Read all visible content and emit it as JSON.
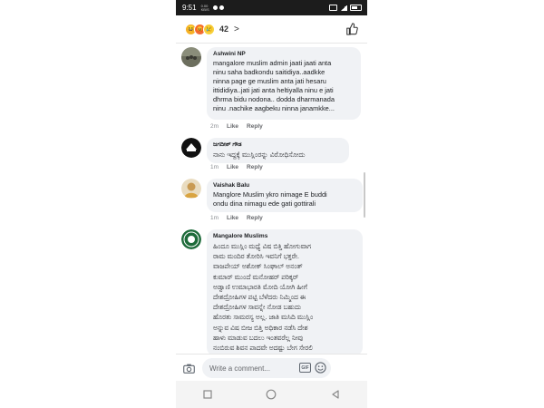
{
  "status_bar": {
    "time": "9:51",
    "network_line1": "0.00",
    "network_line2": "KB/S"
  },
  "reactions": {
    "count": "42",
    "chevron": ">"
  },
  "comments": [
    {
      "author": "Ashwini NP",
      "text": "mangalore muslim admin  jaati jaati anta\nninu saha badkondu saitidiya..aadkke\nninna page ge muslim anta jati hesaru\nittididiya..jati jati anta heltiyalla ninu e jati\ndhrma bidu nodona.. dodda dharmanada\nninu  .nachike aagbeku ninna janamkke...",
      "time": "2m",
      "like": "Like",
      "reply": "Reply"
    },
    {
      "author": "ಜಗದೀಶ್ ಗೌಡ",
      "text": "ನಾನು ಇದ್ದಕ್ಕೆ ಮುಸ್ಲಿಂರನ್ನು ವಿರೋಧಿಸೋದು",
      "time": "1m",
      "like": "Like",
      "reply": "Reply"
    },
    {
      "author": "Vaishak Balu",
      "text": "Manglore Muslim ykro nimage E buddi\nondu dina nimagu ede gati gottirali",
      "time": "1m",
      "like": "Like",
      "reply": "Reply"
    },
    {
      "author": "Mangalore Muslims",
      "text": "ಹಿಂದೂ ಮುಸ್ಲಿಂ ಮಧ್ಯೆ ವಿಷ ಬಿತ್ತಿ  ಹೋಗುವಾಗ\nರಾಮ ಮಂದಿರ ತೋರಿಸಿ ಇವನಿಗೆ ಭಕ್ತರೇ.\nವಾಜಪೇಯ್ ಅಶೋಕ್ ಸಿಂಘಾಲ್ ಅನಂತ್\nಕುಮಾರ್ ಮುಂದೆ ಮನೋಹರ್ ಪರಿಕ್ಕರ್\nಅಡ್ವಾಣಿ ಉಮಾಭಾರತಿ  ಮೋದಿ ಯೋಗಿ ಹೀಗೆ\nದೇಶದ್ರೋಹಿಗಳ ಪಟ್ಟಿ ಬೆಳೆದರು ನಿಮ್ಮಿಂದ ಈ\nದೇಶದ್ರೋಹಿಗಳ ಸಾವನ್ನೇ ನೋಡ ಬಹುದು\nಹೊರತು ಸಾಮರಸ್ಯ ಅಲ್ಲ. ಜಾತಿ ಮಸಿದಿ ಮುಸ್ಲಿಂ\nಅನ್ನುವ ವಿಷ ಬೀಜ ಬಿತ್ತಿ ಅಧಿಕಾರ ನಡೆಸಿ ದೇಶ\nಹಾಳು ಮಾಡುವ ಬದಲು ಇಂತವರೆಲ್ಲ ನೀವು\nನಂಬಿರುವ ಶಿವನ ಪಾದವೇ ಅದಷ್ಟು ಬೇಗ ಸೇರಲಿ"
    }
  ],
  "composer": {
    "placeholder": "Write a comment...",
    "gif_label": "GIF"
  },
  "colors": {
    "bubble": "#f0f2f5",
    "meta": "#8a8d91",
    "status_bar": "#1c1c1c"
  }
}
